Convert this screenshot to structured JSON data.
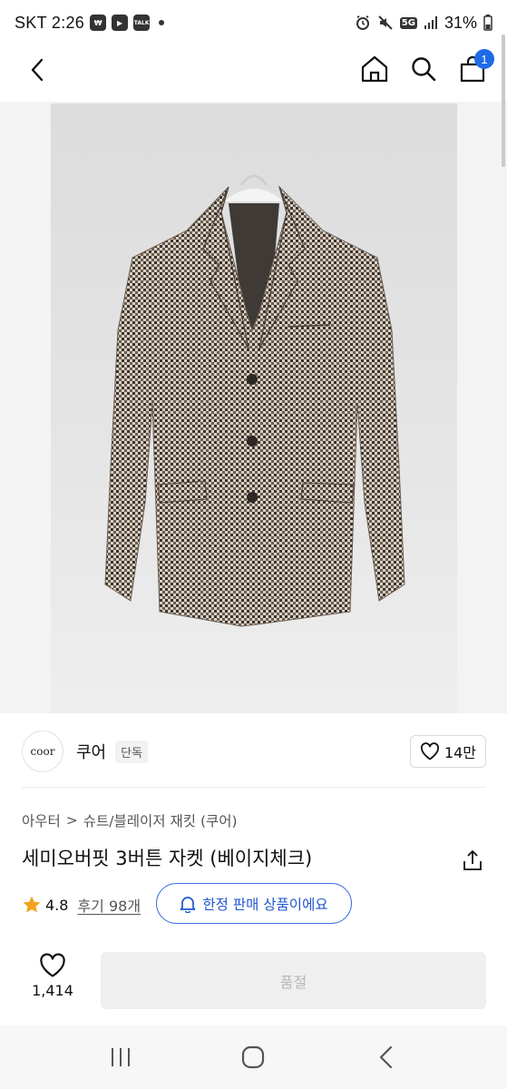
{
  "status_bar": {
    "carrier_time": "SKT 2:26",
    "badges": [
      "pay",
      "youtube",
      "TALK"
    ],
    "network": "5G",
    "battery": "31%"
  },
  "header": {
    "cart_count": "1",
    "icons": [
      "back-icon",
      "home-icon",
      "search-icon",
      "cart-icon"
    ]
  },
  "brand": {
    "logo_text": "coor",
    "name": "쿠어",
    "tag": "단독",
    "likes": "14만"
  },
  "breadcrumb": {
    "category": "아우터",
    "separator": ">",
    "subcategory": "슈트/블레이저 재킷 (쿠어)"
  },
  "product": {
    "title": "세미오버핏 3버튼 자켓 (베이지체크)",
    "rating": "4.8",
    "reviews": "후기 98개",
    "limited_label": "한정 판매 상품이에요"
  },
  "actions": {
    "wish_count": "1,414",
    "soldout_label": "품절"
  },
  "colors": {
    "accent": "#1e6be6",
    "star": "#f2a31b",
    "soldout_bg": "#efefef"
  }
}
